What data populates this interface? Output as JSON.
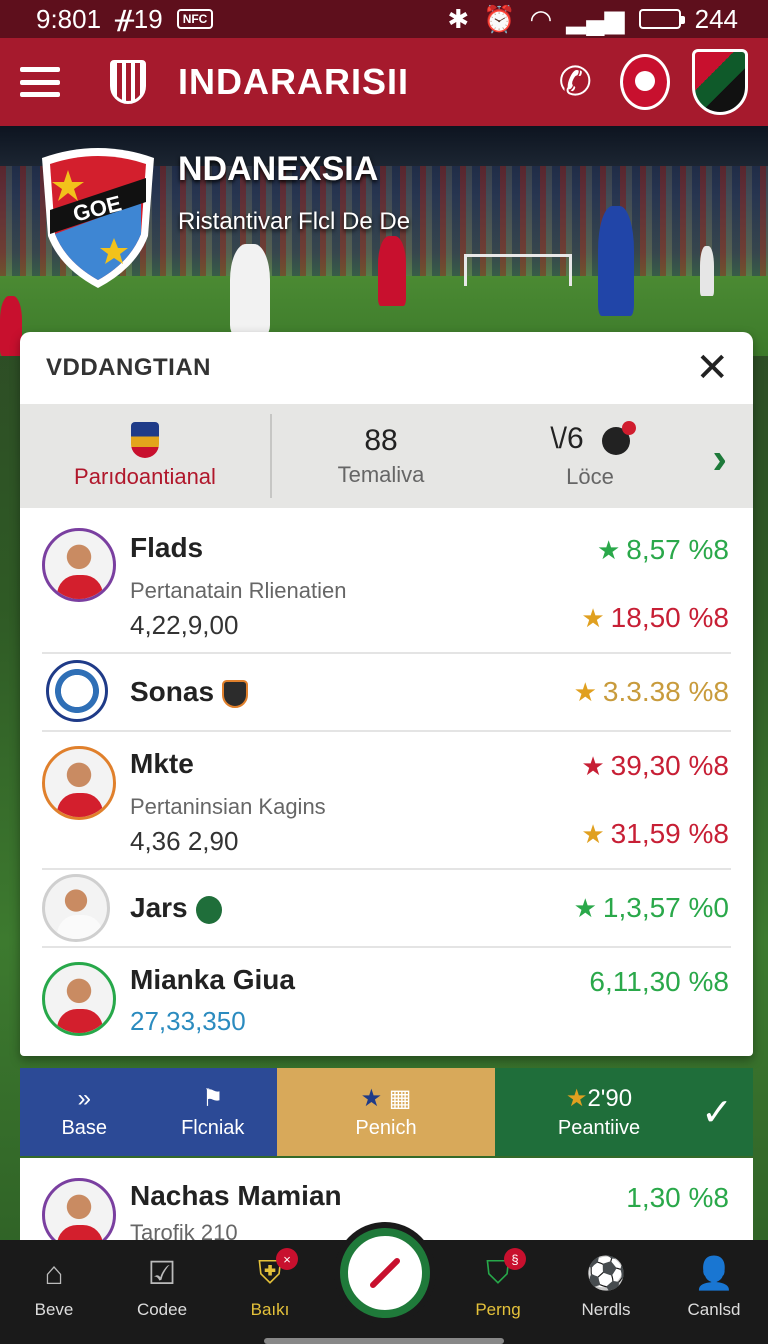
{
  "status_bar": {
    "time": "9:801",
    "icons_left": "ᚌ19",
    "nfc": "NFC",
    "battery": "244"
  },
  "app_bar": {
    "title": "INDARARISII"
  },
  "hero": {
    "title": "NDANEXSIA",
    "subtitle": "Ristantivar Flcl De De",
    "crest_text": "GOE"
  },
  "card": {
    "title": "VDDANGTIAN",
    "close": "✕",
    "stats": {
      "left_label": "Parıdoantianal",
      "mid_value": "88",
      "mid_label": "Temaliva",
      "right_value": "\\/6",
      "right_label": "Löce"
    },
    "rows": [
      {
        "name": "Flads",
        "sub": "Pertanatain Rlienatien",
        "amount": "4,22,9,00",
        "value1": "8,57 %8",
        "value2": "18,50 %8"
      },
      {
        "name": "Sonas",
        "value1": "3.3.38 %8"
      },
      {
        "name": "Mkte",
        "sub": "Pertaninsian Kagins",
        "amount": "4,36 2,90",
        "value1": "39,30 %8",
        "value2": "31,59 %8"
      },
      {
        "name": "Jars",
        "value1": "1,3,57 %0"
      },
      {
        "name": "Mianka Giua",
        "amount": "27,33,350",
        "value1": "6,11,30 %8"
      }
    ]
  },
  "actions": [
    {
      "label": "Base",
      "icon": "chevrons-icon"
    },
    {
      "label": "Flcniak",
      "icon": "flag-icon"
    },
    {
      "label": "Penich",
      "icon": "star-shield-icon"
    },
    {
      "label": "Peantiive",
      "top": "2'90",
      "icon": "check-icon"
    }
  ],
  "card2": {
    "name": "Nachas Mamian",
    "sub": "Tarofik 210",
    "value": "1,30 %8"
  },
  "bottom_nav": [
    {
      "label": "Beve",
      "icon": "home-icon"
    },
    {
      "label": "Codee",
      "icon": "chart-icon"
    },
    {
      "label": "Baıkı",
      "icon": "club-icon",
      "badge": "×"
    },
    {
      "label": "Perng",
      "icon": "pg-icon",
      "badge": "§"
    },
    {
      "label": "Nerdls",
      "icon": "ball-icon"
    },
    {
      "label": "Canlsd",
      "icon": "user-icon"
    }
  ],
  "colors": {
    "primary": "#a61a2d",
    "statusbar": "#5e0f1c",
    "green": "#1f6e3a",
    "blue": "#2c4a96",
    "gold": "#d8a95a"
  }
}
